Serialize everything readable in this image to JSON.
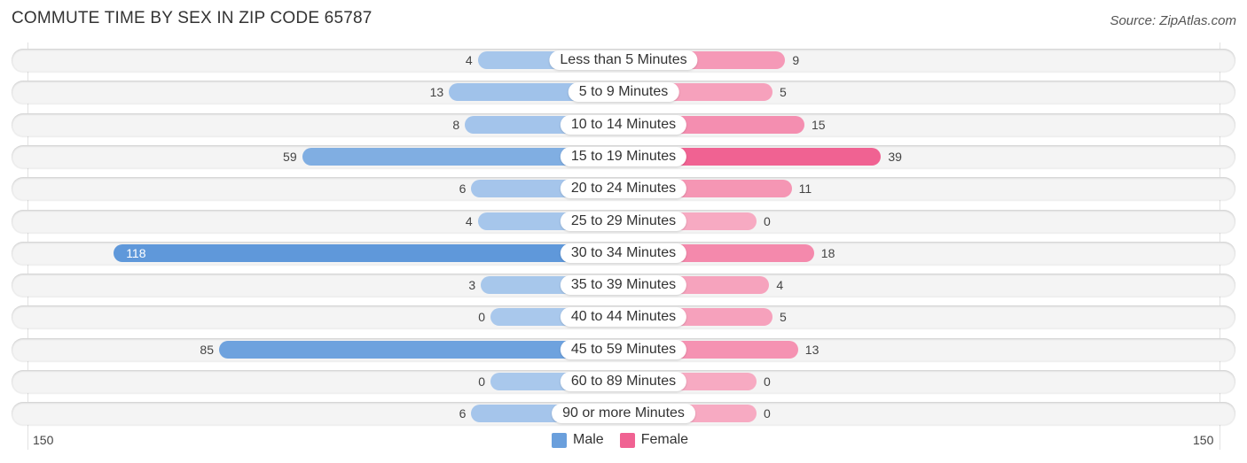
{
  "chart_data": {
    "type": "bar",
    "orientation": "horizontal-diverging",
    "title": "COMMUTE TIME BY SEX IN ZIP CODE 65787",
    "source": "Source: ZipAtlas.com",
    "categories": [
      "Less than 5 Minutes",
      "5 to 9 Minutes",
      "10 to 14 Minutes",
      "15 to 19 Minutes",
      "20 to 24 Minutes",
      "25 to 29 Minutes",
      "30 to 34 Minutes",
      "35 to 39 Minutes",
      "40 to 44 Minutes",
      "45 to 59 Minutes",
      "60 to 89 Minutes",
      "90 or more Minutes"
    ],
    "series": [
      {
        "name": "Male",
        "color": "#6a9fdc",
        "values": [
          4,
          13,
          8,
          59,
          6,
          4,
          118,
          3,
          0,
          85,
          0,
          6
        ]
      },
      {
        "name": "Female",
        "color": "#f06292",
        "values": [
          9,
          5,
          15,
          39,
          11,
          0,
          18,
          4,
          5,
          13,
          0,
          0
        ]
      }
    ],
    "axis": {
      "left_tick": "150",
      "right_tick": "150",
      "range": [
        -150,
        150
      ]
    },
    "legend": {
      "position": "bottom-center",
      "items": [
        "Male",
        "Female"
      ]
    },
    "grid": false
  }
}
